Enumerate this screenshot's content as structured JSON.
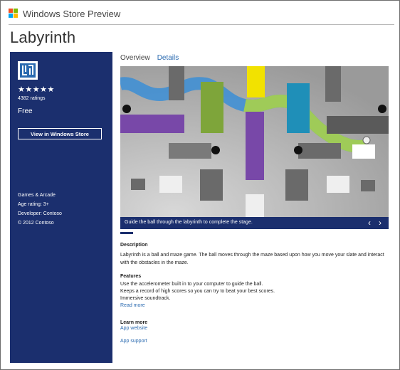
{
  "window": {
    "title": "Windows Store Preview"
  },
  "app": {
    "name": "Labyrinth",
    "rating_stars": "★★★★★",
    "rating_count": "4382 ratings",
    "price": "Free",
    "view_button": "View in Windows Store",
    "category": "Games & Arcade",
    "age_rating": "Age rating: 3+",
    "developer": "Developer: Contoso",
    "copyright": "© 2012 Contoso"
  },
  "tabs": [
    {
      "label": "Overview"
    },
    {
      "label": "Details"
    }
  ],
  "screenshot": {
    "caption": "Guide the ball through the labyrinth to complete the stage.",
    "prev_icon": "chevron-left-icon",
    "next_icon": "chevron-right-icon"
  },
  "description": {
    "heading": "Description",
    "text": "Labyrinth is a ball and maze game. The ball moves through the maze based upon how you move your slate and interact with the obstacles in the maze."
  },
  "features": {
    "heading": "Features",
    "items": [
      "Use the accelerometer built in to your computer to guide the ball.",
      "Keeps a record of high scores so you can try to beat your best scores.",
      "Immersive soundtrack."
    ],
    "read_more": "Read more"
  },
  "learn_more": {
    "heading": "Learn more",
    "app_website": "App website",
    "app_support": "App support"
  },
  "colors": {
    "sidebar": "#1b2f6e",
    "link": "#2a6ab0"
  }
}
